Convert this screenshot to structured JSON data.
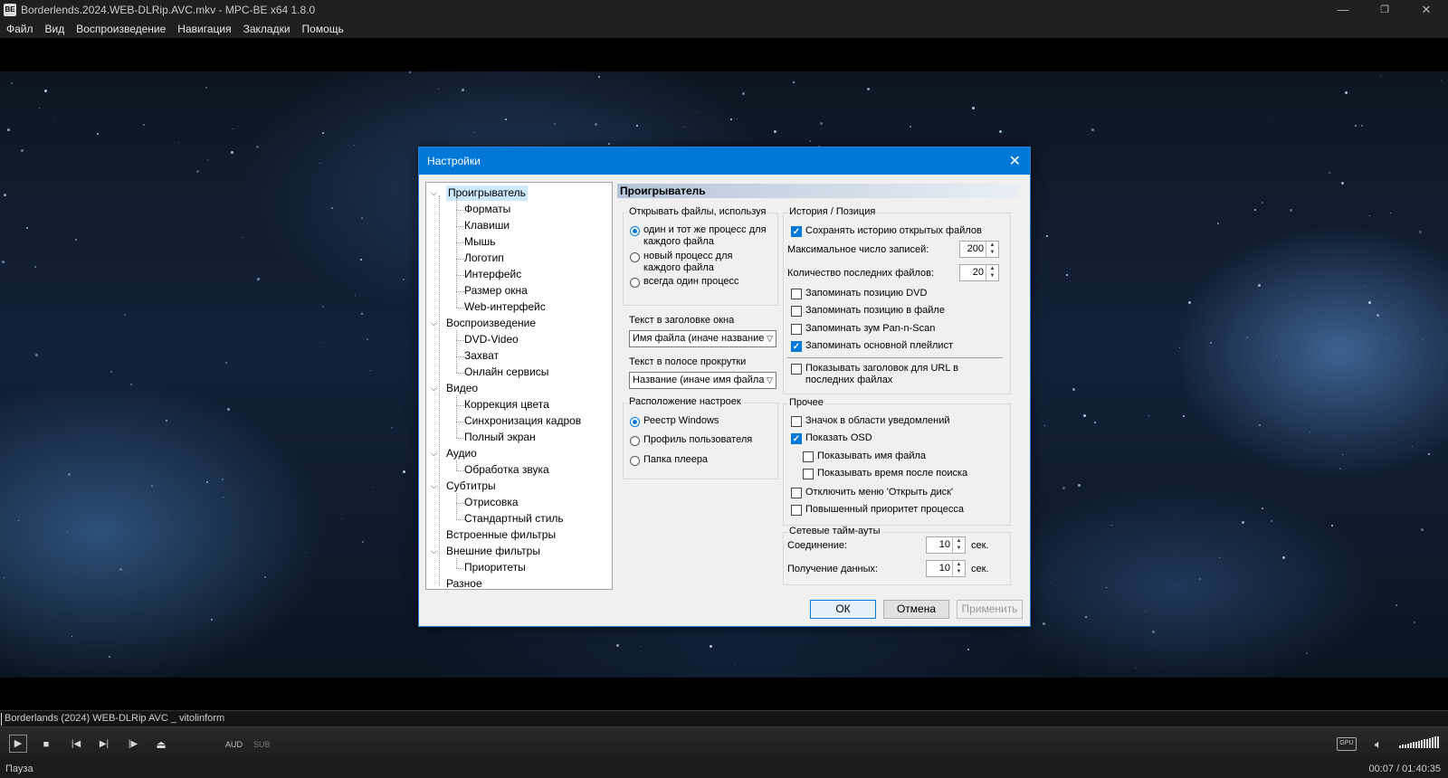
{
  "window": {
    "title": "Borderlends.2024.WEB-DLRip.AVC.mkv - MPC-BE x64 1.8.0",
    "app_icon_text": "BE",
    "minimize": "—",
    "maximize": "❐",
    "close": "✕"
  },
  "menu": [
    "Файл",
    "Вид",
    "Воспроизведение",
    "Навигация",
    "Закладки",
    "Помощь"
  ],
  "dialog": {
    "title": "Настройки",
    "close": "✕",
    "tree": [
      {
        "label": "Проигрыватель",
        "level": 0,
        "expanded": true,
        "selected": true
      },
      {
        "label": "Форматы",
        "level": 1
      },
      {
        "label": "Клавиши",
        "level": 1
      },
      {
        "label": "Мышь",
        "level": 1
      },
      {
        "label": "Логотип",
        "level": 1
      },
      {
        "label": "Интерфейс",
        "level": 1
      },
      {
        "label": "Размер окна",
        "level": 1
      },
      {
        "label": "Web-интерфейс",
        "level": 1
      },
      {
        "label": "Воспроизведение",
        "level": 0,
        "expanded": true
      },
      {
        "label": "DVD-Video",
        "level": 1
      },
      {
        "label": "Захват",
        "level": 1
      },
      {
        "label": "Онлайн сервисы",
        "level": 1
      },
      {
        "label": "Видео",
        "level": 0,
        "expanded": true
      },
      {
        "label": "Коррекция цвета",
        "level": 1
      },
      {
        "label": "Синхронизация кадров",
        "level": 1
      },
      {
        "label": "Полный экран",
        "level": 1
      },
      {
        "label": "Аудио",
        "level": 0,
        "expanded": true
      },
      {
        "label": "Обработка звука",
        "level": 1
      },
      {
        "label": "Субтитры",
        "level": 0,
        "expanded": true
      },
      {
        "label": "Отрисовка",
        "level": 1
      },
      {
        "label": "Стандартный стиль",
        "level": 1
      },
      {
        "label": "Встроенные фильтры",
        "level": 0
      },
      {
        "label": "Внешние фильтры",
        "level": 0,
        "expanded": true
      },
      {
        "label": "Приоритеты",
        "level": 1
      },
      {
        "label": "Разное",
        "level": 0
      }
    ],
    "panel_title": "Проигрыватель",
    "open_files": {
      "legend": "Открывать файлы, используя",
      "options": [
        {
          "label_line1": "один и тот же процесс для",
          "label_line2": "каждого файла",
          "checked": true
        },
        {
          "label_line1": "новый процесс для",
          "label_line2": "каждого файла",
          "checked": false
        },
        {
          "label_line1": "всегда один процесс",
          "label_line2": "",
          "checked": false
        }
      ]
    },
    "window_title_text": {
      "label": "Текст в заголовке окна",
      "value": "Имя файла (иначе название"
    },
    "seekbar_text": {
      "label": "Текст в полосе прокрутки",
      "value": "Название (иначе имя файла"
    },
    "settings_location": {
      "legend": "Расположение настроек",
      "options": [
        {
          "label": "Реестр Windows",
          "checked": true
        },
        {
          "label": "Профиль пользователя",
          "checked": false
        },
        {
          "label": "Папка плеера",
          "checked": false
        }
      ]
    },
    "history": {
      "legend": "История / Позиция",
      "save_history": {
        "label": "Сохранять историю открытых файлов",
        "checked": true
      },
      "max_records": {
        "label": "Максимальное число записей:",
        "value": "200"
      },
      "recent_files": {
        "label": "Количество последних файлов:",
        "value": "20"
      },
      "checks": [
        {
          "label": "Запоминать позицию DVD",
          "checked": false
        },
        {
          "label": "Запоминать позицию в файле",
          "checked": false
        },
        {
          "label": "Запоминать зум Pan-n-Scan",
          "checked": false
        },
        {
          "label": "Запоминать основной плейлист",
          "checked": true
        }
      ],
      "url_titles": {
        "label_line1": "Показывать заголовок для URL в",
        "label_line2": "последних файлах",
        "checked": false
      }
    },
    "other": {
      "legend": "Прочее",
      "checks": [
        {
          "label": "Значок в области уведомлений",
          "checked": false,
          "indent": false
        },
        {
          "label": "Показать OSD",
          "checked": true,
          "indent": false
        },
        {
          "label": "Показывать имя файла",
          "checked": false,
          "indent": true
        },
        {
          "label": "Показывать время после поиска",
          "checked": false,
          "indent": true
        },
        {
          "label": "Отключить меню 'Открыть диск'",
          "checked": false,
          "indent": false
        },
        {
          "label": "Повышенный приоритет процесса",
          "checked": false,
          "indent": false
        }
      ]
    },
    "network": {
      "legend": "Сетевые тайм-ауты",
      "connection": {
        "label": "Соединение:",
        "value": "10",
        "unit": "сек."
      },
      "receive": {
        "label": "Получение данных:",
        "value": "10",
        "unit": "сек."
      }
    },
    "buttons": {
      "ok": "ОК",
      "cancel": "Отмена",
      "apply": "Применить"
    }
  },
  "player": {
    "seekbar_text": "Borderlands (2024) WEB-DLRip AVC _ vitolinform",
    "aud_label": "AUD",
    "sub_label": "SUB",
    "gpu_label": "GPU",
    "status": "Пауза",
    "time": "00:07 / 01:40:35",
    "volume_fraction": 1.0
  }
}
